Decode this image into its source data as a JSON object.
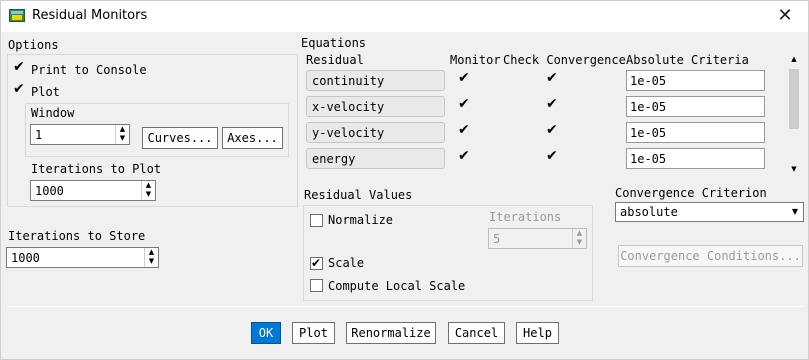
{
  "window": {
    "title": "Residual Monitors",
    "close_glyph": "✕"
  },
  "options": {
    "label": "Options",
    "print_to_console": {
      "label": "Print to Console",
      "checked": true
    },
    "plot": {
      "label": "Plot",
      "checked": true
    },
    "window_label": "Window",
    "window_value": "1",
    "curves_button": "Curves...",
    "axes_button": "Axes...",
    "iterations_to_plot_label": "Iterations to Plot",
    "iterations_to_plot_value": "1000"
  },
  "iterations_to_store": {
    "label": "Iterations to Store",
    "value": "1000"
  },
  "equations": {
    "label": "Equations",
    "headers": {
      "residual": "Residual",
      "monitor": "Monitor",
      "check_convergence": "Check Convergence",
      "absolute_criteria": "Absolute Criteria"
    },
    "rows": [
      {
        "name": "continuity",
        "monitor": true,
        "check": true,
        "criteria": "1e-05"
      },
      {
        "name": "x-velocity",
        "monitor": true,
        "check": true,
        "criteria": "1e-05"
      },
      {
        "name": "y-velocity",
        "monitor": true,
        "check": true,
        "criteria": "1e-05"
      },
      {
        "name": "energy",
        "monitor": true,
        "check": true,
        "criteria": "1e-05"
      }
    ]
  },
  "residual_values": {
    "label": "Residual Values",
    "normalize": {
      "label": "Normalize",
      "checked": false
    },
    "iterations_label": "Iterations",
    "iterations_value": "5",
    "scale": {
      "label": "Scale",
      "checked": true
    },
    "compute_local_scale": {
      "label": "Compute Local Scale",
      "checked": false
    }
  },
  "convergence": {
    "label": "Convergence Criterion",
    "selected": "absolute",
    "conditions_button": "Convergence Conditions..."
  },
  "buttons": {
    "ok": "OK",
    "plot": "Plot",
    "renormalize": "Renormalize",
    "cancel": "Cancel",
    "help": "Help"
  }
}
